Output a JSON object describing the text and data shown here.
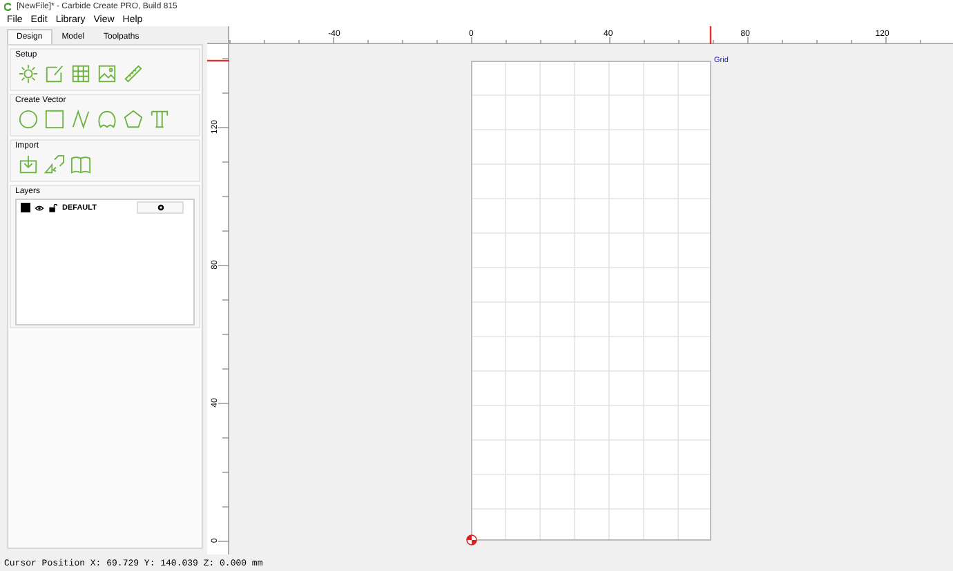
{
  "window": {
    "title": "[NewFile]* - Carbide Create PRO, Build 815"
  },
  "menu": [
    {
      "label": "File"
    },
    {
      "label": "Edit"
    },
    {
      "label": "Library"
    },
    {
      "label": "View"
    },
    {
      "label": "Help"
    }
  ],
  "tabs": [
    {
      "label": "Design",
      "selected": true
    },
    {
      "label": "Model",
      "selected": false
    },
    {
      "label": "Toolpaths",
      "selected": false
    }
  ],
  "sections": [
    {
      "title": "Setup"
    },
    {
      "title": "Create Vector"
    },
    {
      "title": "Import"
    }
  ],
  "layers": {
    "title": "Layers",
    "items": [
      {
        "name": "DEFAULT",
        "color": "#000000"
      }
    ]
  },
  "canvas": {
    "grid_label": "Grid",
    "h_ruler": [
      "-40",
      "0",
      "40",
      "80",
      "120"
    ],
    "v_ruler": [
      "120",
      "80",
      "40",
      "0"
    ]
  },
  "status_bar": "Cursor Position X: 69.729 Y: 140.039 Z: 0.000 mm"
}
